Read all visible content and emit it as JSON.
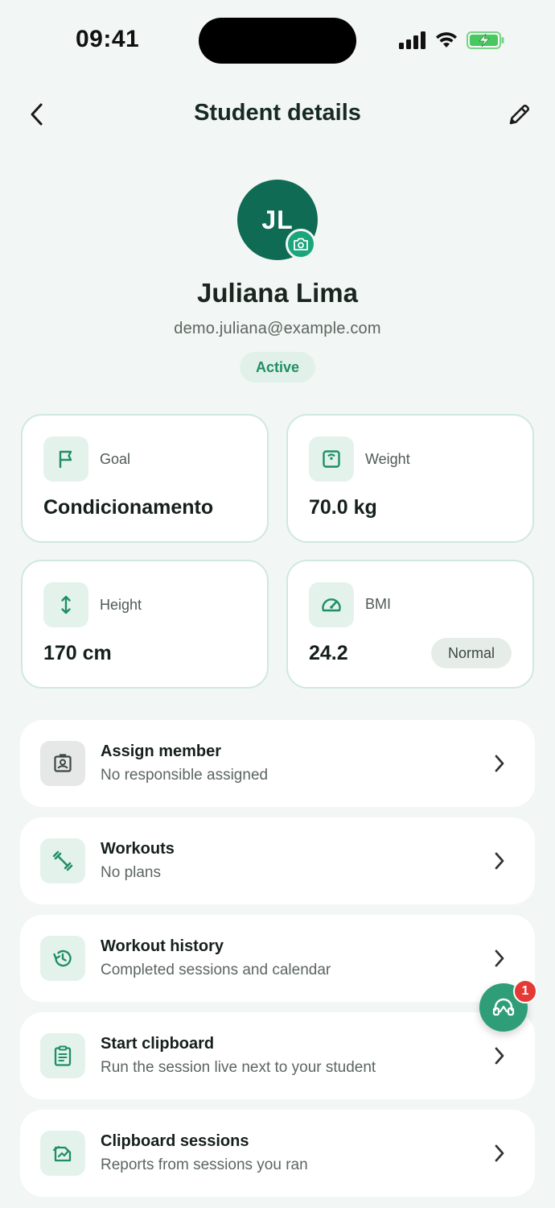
{
  "status_bar": {
    "time": "09:41"
  },
  "header": {
    "title": "Student details"
  },
  "profile": {
    "initials": "JL",
    "name": "Juliana Lima",
    "email": "demo.juliana@example.com",
    "status": "Active"
  },
  "stats": {
    "goal": {
      "label": "Goal",
      "value": "Condicionamento"
    },
    "weight": {
      "label": "Weight",
      "value": "70.0 kg"
    },
    "height": {
      "label": "Height",
      "value": "170 cm"
    },
    "bmi": {
      "label": "BMI",
      "value": "24.2",
      "badge": "Normal"
    }
  },
  "menu": [
    {
      "title": "Assign member",
      "subtitle": "No responsible assigned"
    },
    {
      "title": "Workouts",
      "subtitle": "No plans"
    },
    {
      "title": "Workout history",
      "subtitle": "Completed sessions and calendar"
    },
    {
      "title": "Start clipboard",
      "subtitle": "Run the session live next to your student"
    },
    {
      "title": "Clipboard sessions",
      "subtitle": "Reports from sessions you ran"
    }
  ],
  "support_fab": {
    "badge_count": "1"
  },
  "colors": {
    "accent": "#1aa57a",
    "avatar_bg": "#0f6b54",
    "icon_tile_bg": "#e3f3ec",
    "badge_red": "#e53935"
  }
}
